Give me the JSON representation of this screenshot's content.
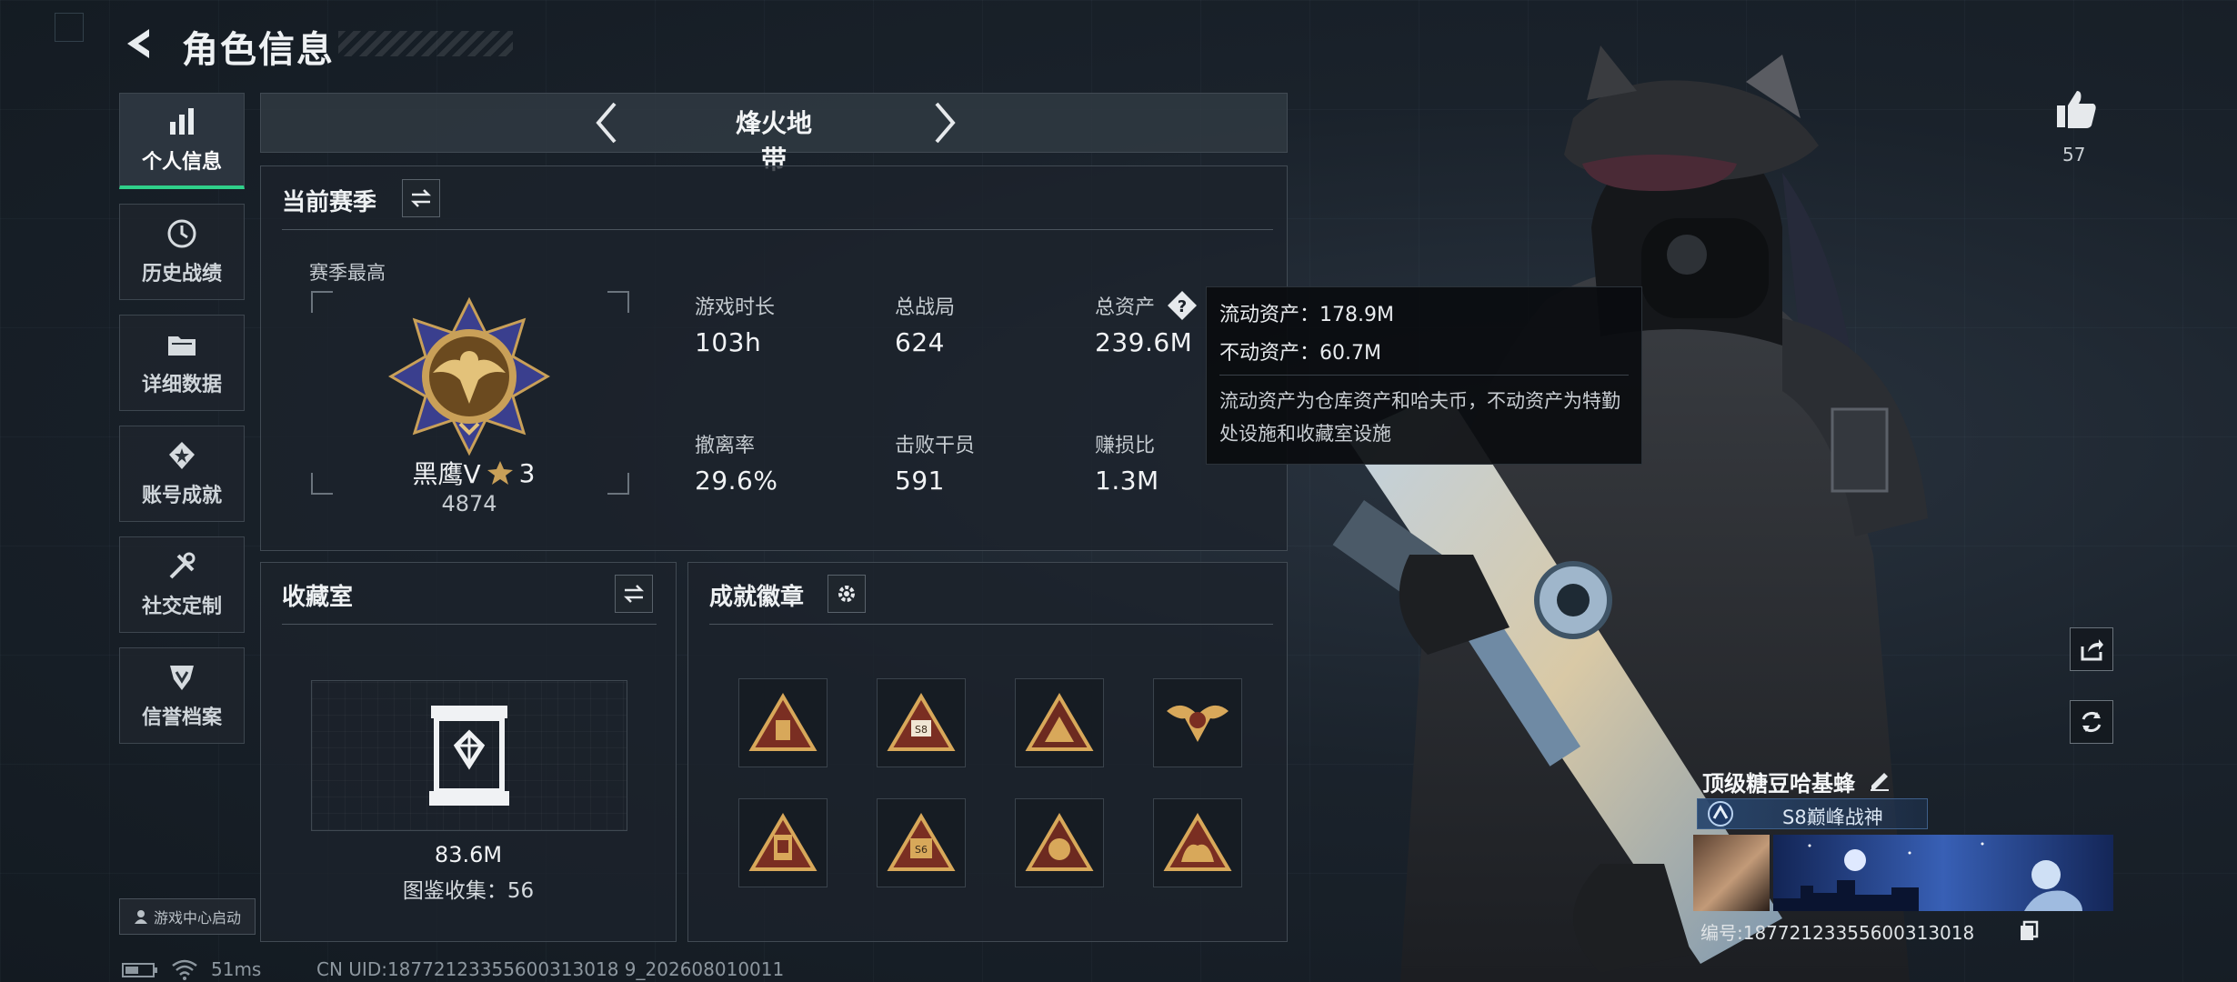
{
  "header": {
    "title": "角色信息"
  },
  "sidebar": {
    "items": [
      {
        "label": "个人信息",
        "icon": "bar-chart-icon"
      },
      {
        "label": "历史战绩",
        "icon": "history-icon"
      },
      {
        "label": "详细数据",
        "icon": "folder-icon"
      },
      {
        "label": "账号成就",
        "icon": "achievement-icon"
      },
      {
        "label": "社交定制",
        "icon": "tools-icon"
      },
      {
        "label": "信誉档案",
        "icon": "shield-icon"
      }
    ],
    "launch_label": "游戏中心启动"
  },
  "mode_tabs": {
    "current": "烽火地带"
  },
  "season": {
    "heading": "当前赛季",
    "best_label": "赛季最高",
    "rank_name": "黑鹰V",
    "rank_stars": "3",
    "rank_points": "4874",
    "stats": [
      {
        "label": "游戏时长",
        "value": "103h"
      },
      {
        "label": "总战局",
        "value": "624"
      },
      {
        "label": "总资产",
        "value": "239.6M"
      },
      {
        "label": "撤离率",
        "value": "29.6%"
      },
      {
        "label": "击败干员",
        "value": "591"
      },
      {
        "label": "赚损比",
        "value": "1.3M"
      }
    ]
  },
  "tooltip": {
    "liquid": "流动资产：178.9M",
    "fixed": "不动资产：60.7M",
    "desc": "流动资产为仓库资产和哈夫币，不动资产为特勤处设施和收藏室设施"
  },
  "collection": {
    "heading": "收藏室",
    "value": "83.6M",
    "catalog": "图鉴收集：56"
  },
  "badges": {
    "heading": "成就徽章"
  },
  "profile": {
    "likes": "57",
    "player_name": "顶级糖豆哈基蜂",
    "rank_title": "S8巅峰战神",
    "uid_card": "编号:18772123355600313018"
  },
  "status": {
    "ping": "51ms",
    "uid": "CN UID:18772123355600313018 9_202608010011"
  },
  "colors": {
    "accent": "#2fd08a",
    "gold": "#c9a058"
  }
}
